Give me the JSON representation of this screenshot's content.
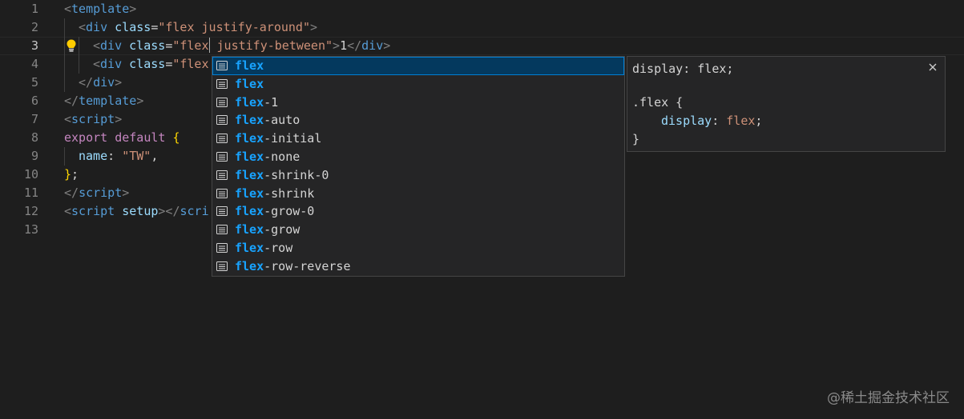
{
  "gutter": {
    "line_numbers": [
      "1",
      "2",
      "3",
      "4",
      "5",
      "6",
      "7",
      "8",
      "9",
      "10",
      "11",
      "12",
      "13"
    ],
    "active_line": "3"
  },
  "code": {
    "l1": {
      "open": "<",
      "tag": "template",
      "close": ">"
    },
    "l2": {
      "open": "<",
      "tag": "div",
      "attr": "class",
      "eq": "=",
      "value": "\"flex justify-around\"",
      "close": ">"
    },
    "l3": {
      "open": "<",
      "tag": "div",
      "attr": "class",
      "eq": "=",
      "value_a": "\"flex",
      "value_b": " justify-between\"",
      "close": ">",
      "text": "1",
      "end_open": "</",
      "end_tag": "div",
      "end_close": ">"
    },
    "l4": {
      "open": "<",
      "tag": "div",
      "attr": "class",
      "eq": "=",
      "value": "\"flex"
    },
    "l5": {
      "open": "</",
      "tag": "div",
      "close": ">"
    },
    "l6": {
      "open": "</",
      "tag": "template",
      "close": ">"
    },
    "l7": {
      "open": "<",
      "tag": "script",
      "close": ">"
    },
    "l8": {
      "kw1": "export",
      "kw2": "default",
      "brace": "{"
    },
    "l9": {
      "prop": "name",
      "colon": ": ",
      "value": "\"TW\"",
      "comma": ","
    },
    "l10": {
      "brace": "}",
      "semi": ";"
    },
    "l11": {
      "open": "</",
      "tag": "script",
      "close": ">"
    },
    "l12": {
      "open": "<",
      "tag": "script",
      "attr": "setup",
      "close": "></",
      "tag2": "scri"
    }
  },
  "suggest": {
    "items": [
      {
        "match": "flex",
        "rest": ""
      },
      {
        "match": "flex",
        "rest": ""
      },
      {
        "match": "flex",
        "rest": "-1"
      },
      {
        "match": "flex",
        "rest": "-auto"
      },
      {
        "match": "flex",
        "rest": "-initial"
      },
      {
        "match": "flex",
        "rest": "-none"
      },
      {
        "match": "flex",
        "rest": "-shrink-0"
      },
      {
        "match": "flex",
        "rest": "-shrink"
      },
      {
        "match": "flex",
        "rest": "-grow-0"
      },
      {
        "match": "flex",
        "rest": "-grow"
      },
      {
        "match": "flex",
        "rest": "-row"
      },
      {
        "match": "flex",
        "rest": "-row-reverse"
      }
    ],
    "selected_index": 0
  },
  "details": {
    "summary": "display: flex;",
    "selector": ".flex",
    "open_brace": " {",
    "prop": "display",
    "colon": ": ",
    "value": "flex",
    "semi": ";",
    "close_brace": "}"
  },
  "watermark": "@稀土掘金技术社区",
  "colors": {
    "background": "#1e1e1e",
    "tag": "#569cd6",
    "attribute": "#9cdcfe",
    "string": "#ce9178",
    "keyword": "#c586c0",
    "match_highlight": "#18a3ff",
    "selected_item": "#04395e"
  },
  "icons": {
    "lightbulb": "lightbulb-icon",
    "suggestion_kind": "text-lines-icon",
    "close": "close-icon"
  }
}
